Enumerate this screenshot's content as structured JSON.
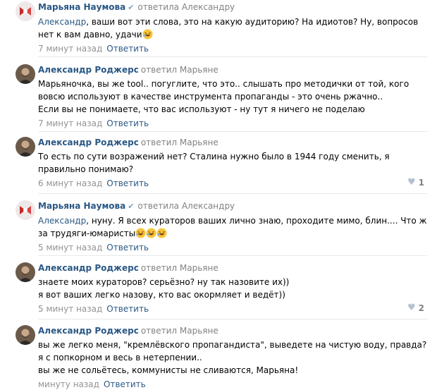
{
  "labels": {
    "reply_button": "Ответить"
  },
  "comments": [
    {
      "author": "Марьяна Наумова",
      "verified": true,
      "reply_to": "ответила Александру",
      "mention": "Александр",
      "lines": [
        ", ваши вот эти слова, это на какую аудиторию? На идиотов? Ну, вопросов",
        "нет к вам давно, удачи"
      ],
      "emoji_count": 1,
      "time": "7 минут назад",
      "likes": null
    },
    {
      "author": "Александр Роджерс",
      "verified": false,
      "reply_to": "ответил Марьяне",
      "lines": [
        "Марьяночка, вы же tool.. погуглите, что это.. слышать про методички от той, кого",
        "вовсю используют в качестве инструмента пропаганды - это очень ржачно..",
        "Если вы не понимаете, что вас используют - ну тут я ничего не поделаю"
      ],
      "time": "7 минут назад",
      "likes": null
    },
    {
      "author": "Александр Роджерс",
      "verified": false,
      "reply_to": "ответил Марьяне",
      "lines": [
        "То есть по сути возражений нет? Сталина нужно было в 1944 году сменить, я",
        "правильно понимаю?"
      ],
      "time": "6 минут назад",
      "likes": "1"
    },
    {
      "author": "Марьяна Наумова",
      "verified": true,
      "reply_to": "ответила Александру",
      "mention": "Александр",
      "lines": [
        ", нуну. Я всех кураторов ваших лично знаю, проходите мимо, блин.... Что ж",
        "за трудяги-юмаристы"
      ],
      "emoji_count": 3,
      "time": "5 минут назад",
      "likes": null
    },
    {
      "author": "Александр Роджерс",
      "verified": false,
      "reply_to": "ответил Марьяне",
      "lines": [
        "знаете моих кураторов? серьёзно? ну так назовите их))",
        "я вот ваших легко назову, кто вас окормляет и ведёт))"
      ],
      "time": "5 минут назад",
      "likes": "2"
    },
    {
      "author": "Александр Роджерс",
      "verified": false,
      "reply_to": "ответил Марьяне",
      "lines": [
        "вы же легко меня, \"кремлёвского пропагандиста\", выведете на чистую воду, правда?",
        "я с попкорном и весь в нетерпении..",
        "вы же не сольётесь, коммунисты не сливаются, Марьяна!"
      ],
      "time": "минуту назад",
      "likes": null
    }
  ]
}
